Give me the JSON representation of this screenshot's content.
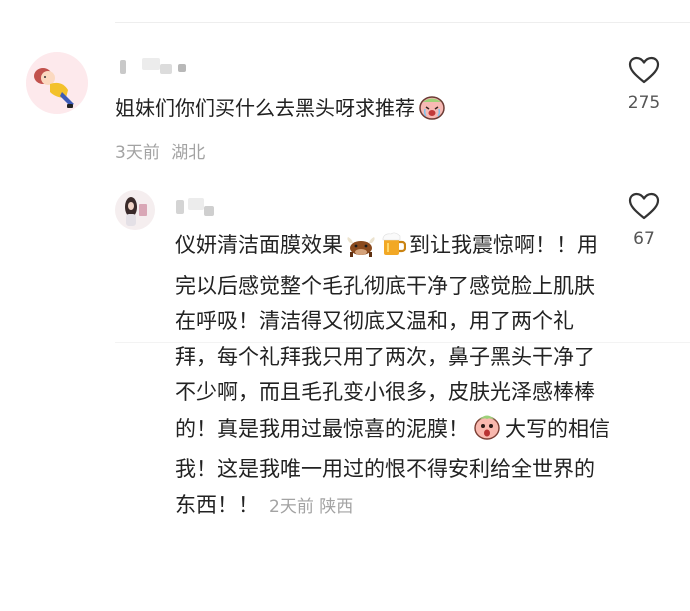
{
  "comments": [
    {
      "text": "姐妹们你们买什么去黑头呀求推荐",
      "emoji": "crying-face-sticker",
      "time": "3天前",
      "location": "湖北",
      "likes": "275"
    }
  ],
  "reply": {
    "text_a": "仪妍清洁面膜效果",
    "emoji_a": "bull-face",
    "emoji_b": "beer-mug",
    "text_b": "到让我震惊啊！！用完以后感觉整个毛孔彻底干净了感觉脸上肌肤在呼吸！清洁得又彻底又温和，用了两个礼拜，每个礼拜我只用了两次，鼻子黑头干净了不少啊，而且毛孔变小很多，皮肤光泽感棒棒的！真是我用过最惊喜的泥膜！",
    "emoji_c": "shocked-peach-sticker",
    "text_c": "大写的相信我！这是我唯一用过的恨不得安利给全世界的东西！！",
    "time": "2天前",
    "location": "陕西",
    "likes": "67"
  },
  "colors": {
    "meta": "#a3a3a3",
    "text": "#202020",
    "like_outline": "#333333"
  }
}
